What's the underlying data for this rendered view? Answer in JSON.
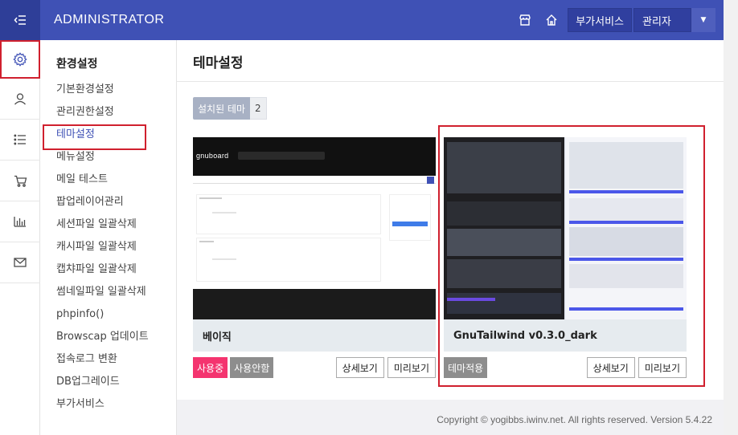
{
  "header": {
    "brand": "ADMINISTRATOR",
    "addons_label": "부가서비스",
    "admin_label": "관리자"
  },
  "colors": {
    "topbar": "#3f51b5",
    "accent_pink": "#f4346f",
    "highlight_red": "#d0202e"
  },
  "rail": {
    "icons": [
      "settings-icon",
      "user-icon",
      "list-icon",
      "cart-icon",
      "chart-icon",
      "mail-icon"
    ]
  },
  "submenu": {
    "title": "환경설정",
    "items": [
      {
        "label": "기본환경설정"
      },
      {
        "label": "관리권한설정"
      },
      {
        "label": "테마설정"
      },
      {
        "label": "메뉴설정"
      },
      {
        "label": "메일 테스트"
      },
      {
        "label": "팝업레이어관리"
      },
      {
        "label": "세션파일 일괄삭제"
      },
      {
        "label": "캐시파일 일괄삭제"
      },
      {
        "label": "캡챠파일 일괄삭제"
      },
      {
        "label": "썸네일파일 일괄삭제"
      },
      {
        "label": "phpinfo()"
      },
      {
        "label": "Browscap 업데이트"
      },
      {
        "label": "접속로그 변환"
      },
      {
        "label": "DB업그레이드"
      },
      {
        "label": "부가서비스"
      }
    ]
  },
  "page": {
    "title": "테마설정",
    "installed_label": "설치된 테마",
    "installed_count": "2"
  },
  "themes": [
    {
      "name": "베이직",
      "thumb_logo": "gnuboard",
      "status_in_use": "사용중",
      "status_unused": "사용안함",
      "detail": "상세보기",
      "preview": "미리보기"
    },
    {
      "name": "GnuTailwind v0.3.0_dark",
      "apply": "테마적용",
      "detail": "상세보기",
      "preview": "미리보기"
    }
  ],
  "footer": {
    "copyright": "Copyright © yogibbs.iwinv.net. All rights reserved. Version 5.4.22"
  }
}
